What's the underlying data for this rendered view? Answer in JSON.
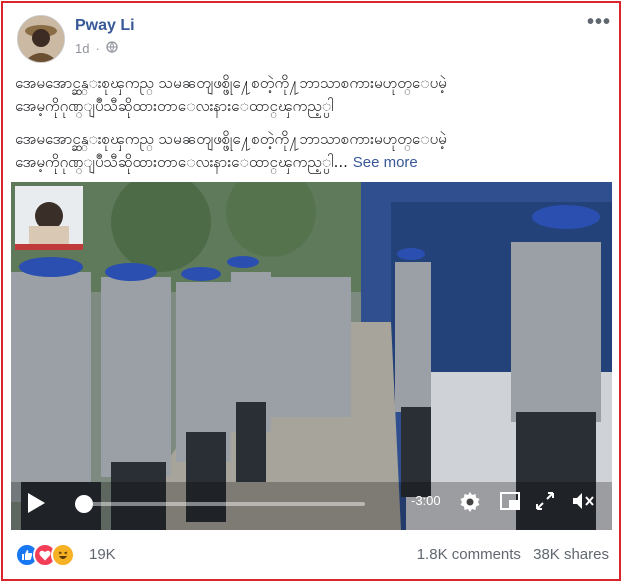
{
  "post": {
    "author": "Pway Li",
    "time": "1d",
    "privacy_icon": "globe-icon",
    "more_icon": "ellipsis-icon",
    "text_line1": "အေမအောင္ဆန္းစုၾကည္ သမၼတျဖစ္ဖို႔ေစတဲ့ကို႔ဘာသာစကားမဟုတ္ေပမဲ့",
    "text_line2": "အေမ့ကိုဂုဏ္ျပဳသီဆိုထားတာေလးနားေထာင္ၾကည့္ပါ",
    "text_line3": "အေမအောင္ဆန္းစုၾကည္ သမၼတျဖစ္ဖို႔ေစတဲ့ကို႔ဘာသာစကားမဟုတ္ေပမဲ့",
    "text_line4": "အေမ့ကိုဂုဏ္ျပဳသီဆိုထားတာေလးနားေထာင္ၾကည့္ပါ...",
    "see_more": "See more"
  },
  "video": {
    "time_remaining": "-3:00",
    "played_fraction": 0.0,
    "icons": [
      "play-icon",
      "settings-icon",
      "pip-icon",
      "fullscreen-icon",
      "mute-icon"
    ]
  },
  "stats": {
    "reaction_icons": [
      "like-icon",
      "love-icon",
      "haha-icon"
    ],
    "reactions_count": "19K",
    "comments": "1.8K comments",
    "shares": "38K shares"
  },
  "colors": {
    "author": "#385898",
    "border": "#d9262c",
    "like": "#1877f2",
    "love": "#f33e58",
    "haha": "#f7b125"
  }
}
